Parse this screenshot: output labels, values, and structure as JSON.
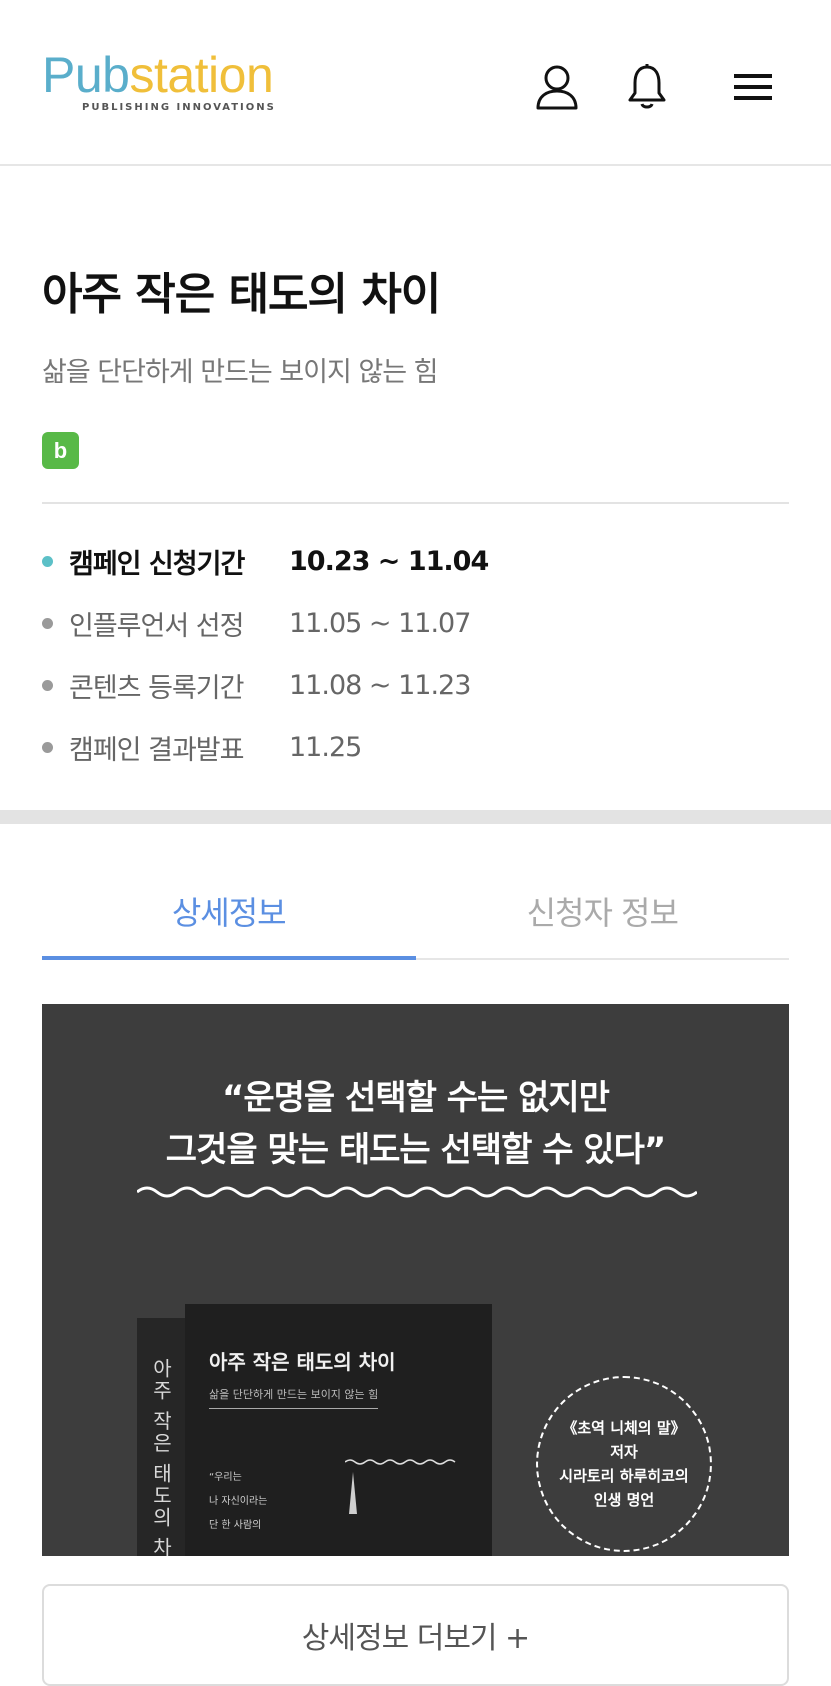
{
  "header": {
    "logo_pub": "Pub",
    "logo_station": "station",
    "logo_tagline": "PUBLISHING INNOVATIONS",
    "icons": [
      "user-icon",
      "bell-icon",
      "menu-icon"
    ]
  },
  "campaign": {
    "title": "아주 작은 태도의 차이",
    "subtitle": "삶을 단단하게 만드는 보이지 않는 힘",
    "badge": "b",
    "badge_color": "#58b947",
    "schedule": [
      {
        "label": "캠페인 신청기간",
        "date": "10.23 ~ 11.04",
        "active": true
      },
      {
        "label": "인플루언서 선정",
        "date": "11.05 ~ 11.07",
        "active": false
      },
      {
        "label": "콘텐츠 등록기간",
        "date": "11.08 ~ 11.23",
        "active": false
      },
      {
        "label": "캠페인 결과발표",
        "date": "11.25",
        "active": false
      }
    ]
  },
  "tabs": [
    {
      "label": "상세정보",
      "active": true
    },
    {
      "label": "신청자 정보",
      "active": false
    }
  ],
  "banner": {
    "quote_line1": "“운명을 선택할 수는 없지만",
    "quote_line2": "그것을 맞는 태도는 선택할 수 있다”",
    "book_spine": "아주 작은 태도의 차이",
    "book_title": "아주 작은 태도의 차이",
    "book_subtitle": "삶을 단단하게 만드는 보이지 않는 힘",
    "book_line1": "“우리는",
    "book_line2": "나 자신이라는",
    "book_line3": "단 한 사람의",
    "stamp_line1": "《초역 니체의 말》",
    "stamp_line2": "저자",
    "stamp_line3": "시라토리 하루히코의",
    "stamp_line4": "인생 명언"
  },
  "more_button": "상세정보 더보기 +",
  "colors": {
    "accent_blue": "#5b8fe2",
    "active_dot": "#5cc0c7",
    "logo_blue": "#5aaecb",
    "logo_yellow": "#f0bf3a"
  }
}
